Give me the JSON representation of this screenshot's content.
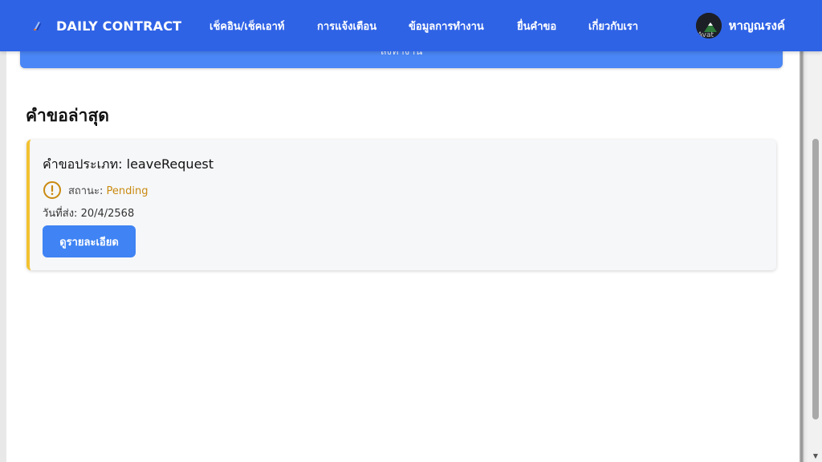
{
  "navbar": {
    "brand_name": "DAILY CONTRACT",
    "links": [
      {
        "label": "เช็คอิน/เช็คเอาท์"
      },
      {
        "label": "การแจ้งเตือน"
      },
      {
        "label": "ข้อมูลการทำงาน"
      },
      {
        "label": "ยื่นคำขอ"
      },
      {
        "label": "เกี่ยวกับเรา"
      }
    ],
    "user": {
      "name": "หาญณรงค์",
      "avatar_alt": "Avat"
    },
    "colors": {
      "background": "#2f63e6"
    }
  },
  "top_button": {
    "label": "ลงทำงาน"
  },
  "latest_requests": {
    "title": "คำขอล่าสุด",
    "items": [
      {
        "type_label": "คำขอประเภท:",
        "type_value": "leaveRequest",
        "status_label": "สถานะ:",
        "status_value": "Pending",
        "status_icon": "warning-circle-icon",
        "status_color": "#c98a10",
        "date_label": "วันที่ส่ง:",
        "date_value": "20/4/2568",
        "detail_button": "ดูรายละเอียด"
      }
    ]
  }
}
